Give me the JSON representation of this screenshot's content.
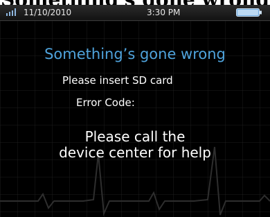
{
  "caption": {
    "text": "Something's gone wrong"
  },
  "status_bar": {
    "signal_icon": "signal-strength-icon",
    "date": "11/10/2010",
    "time": "3:30 PM",
    "battery_icon": "battery-icon"
  },
  "error": {
    "title": "Something’s gone wrong",
    "message": "Please insert SD card",
    "code_label": "Error Code:",
    "help_line_1": "Please call the",
    "help_line_2": "device center for help"
  },
  "colors": {
    "screen_background": "#000000",
    "title_color": "#4fa3dc",
    "text_color": "#ffffff",
    "grid_color": "#1d1d1d",
    "trace_color": "#2e2e2e"
  }
}
